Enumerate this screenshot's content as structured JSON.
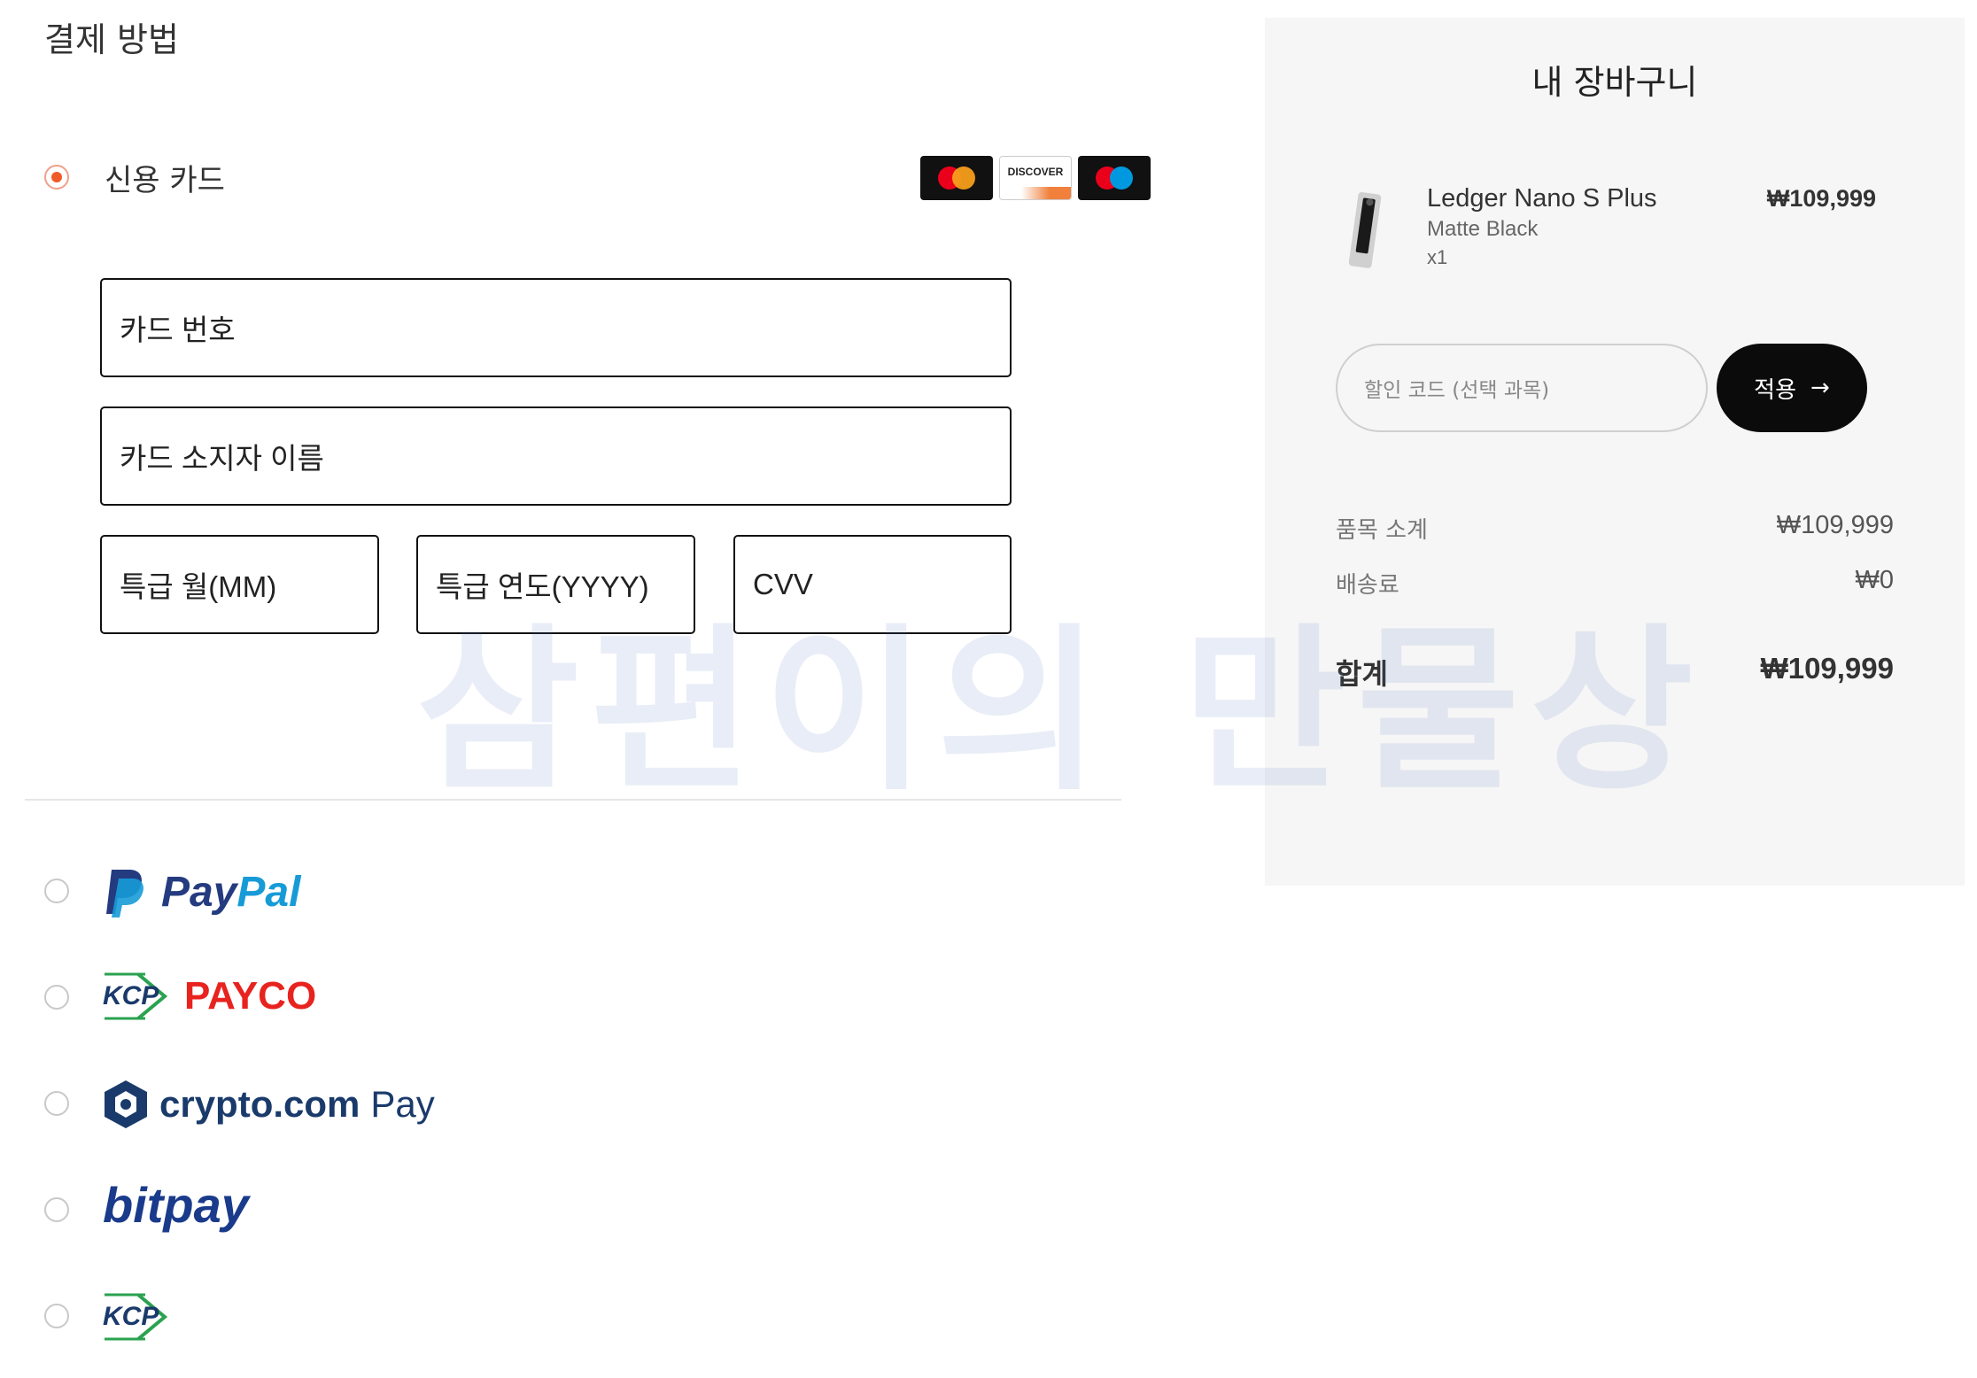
{
  "payment": {
    "title": "결제 방법",
    "credit_card_label": "신용 카드",
    "card_brands": {
      "mastercard": "mastercard",
      "discover": "DISCOVER",
      "maestro": "maestro"
    },
    "fields": {
      "card_number": "카드 번호",
      "card_holder": "카드 소지자 이름",
      "exp_month": "특급 월(MM)",
      "exp_year": "특급 연도(YYYY)",
      "cvv": "CVV"
    },
    "methods": {
      "paypal": {
        "part1": "Pay",
        "part2": "Pal"
      },
      "payco": {
        "kcp": "KCP",
        "name": "PAYCO"
      },
      "crypto": {
        "name": "crypto.com",
        "suffix": "Pay"
      },
      "bitpay": {
        "name": "bitpay"
      },
      "kcp": {
        "kcp": "KCP"
      }
    }
  },
  "cart": {
    "title": "내 장바구니",
    "item": {
      "name": "Ledger Nano S Plus",
      "variant": "Matte Black",
      "qty": "x1",
      "price": "₩109,999"
    },
    "coupon_placeholder": "할인 코드 (선택 과목)",
    "apply_label": "적용",
    "apply_arrow": "→",
    "subtotal_label": "품목 소계",
    "subtotal_value": "₩109,999",
    "shipping_label": "배송료",
    "shipping_value": "₩0",
    "total_label": "합계",
    "total_value": "₩109,999"
  },
  "watermark": "삼편이의 만물상",
  "colors": {
    "accent": "#f05a28",
    "paypal_dark": "#253b80",
    "paypal_light": "#179bd7",
    "payco_red": "#e8231f",
    "crypto_navy": "#1a3a6b",
    "bitpay_navy": "#1a3b8b",
    "kcp_green": "#2aa24f"
  }
}
